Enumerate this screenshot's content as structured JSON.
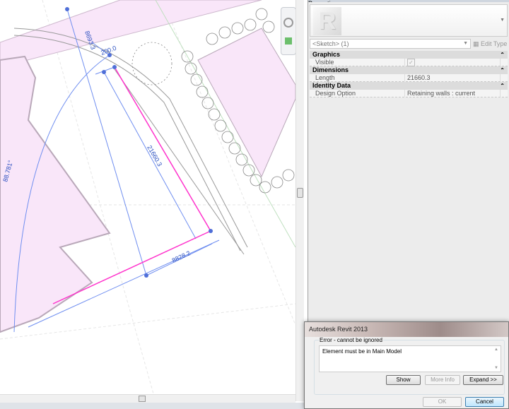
{
  "canvas": {
    "dimensions": [
      "8693.3",
      "200.0",
      "21660.3",
      "8828.2",
      "88.781°"
    ],
    "colors": {
      "building_fill": "#f9e6f9",
      "sketch_line": "#6f8ef0",
      "wall_line": "#ff33cc",
      "grip": "#4f6fd8"
    }
  },
  "navigation": {
    "icons": [
      "steering-wheel-icon",
      "zoom-region-icon"
    ]
  },
  "properties": {
    "title": "Properties",
    "type_selector": "<Sketch> (1)",
    "edit_type": "Edit Type",
    "categories": [
      {
        "name": "Graphics",
        "rows": [
          {
            "key": "Visible",
            "value": "✓"
          }
        ]
      },
      {
        "name": "Dimensions",
        "rows": [
          {
            "key": "Length",
            "value": "21660.3"
          }
        ]
      },
      {
        "name": "Identity Data",
        "rows": [
          {
            "key": "Design Option",
            "value": "Retaining walls : current"
          }
        ]
      }
    ]
  },
  "dialog": {
    "title": "Autodesk Revit 2013",
    "group_label": "Error - cannot be ignored",
    "message": "Element must be in Main Model",
    "buttons": {
      "show": "Show",
      "more_info": "More Info",
      "expand": "Expand >>",
      "ok": "OK",
      "cancel": "Cancel"
    }
  }
}
